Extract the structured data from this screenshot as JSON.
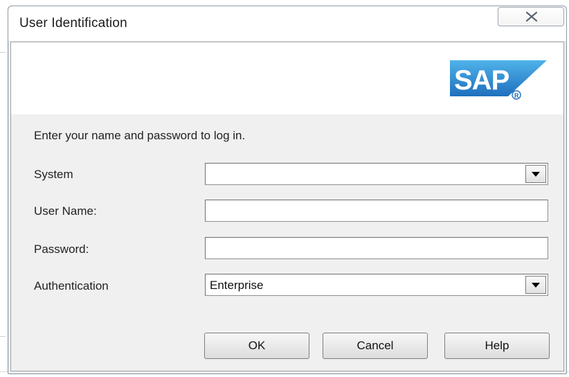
{
  "window": {
    "title": "User Identification",
    "close_icon": "close-x-icon"
  },
  "banner": {
    "logo_text": "SAP",
    "logo_colors": {
      "blue_top": "#4fb3ea",
      "blue_bottom": "#1f6fbd",
      "text": "#ffffff"
    }
  },
  "prompt": "Enter your name and password to log in.",
  "fields": {
    "system": {
      "label": "System",
      "value": "",
      "dropdown_icon": "chevron-down-icon"
    },
    "user_name": {
      "label": "User Name:",
      "value": ""
    },
    "password": {
      "label": "Password:",
      "value": ""
    },
    "authentication": {
      "label": "Authentication",
      "value": "Enterprise",
      "dropdown_icon": "chevron-down-icon"
    }
  },
  "buttons": {
    "ok": "OK",
    "cancel": "Cancel",
    "help": "Help"
  }
}
